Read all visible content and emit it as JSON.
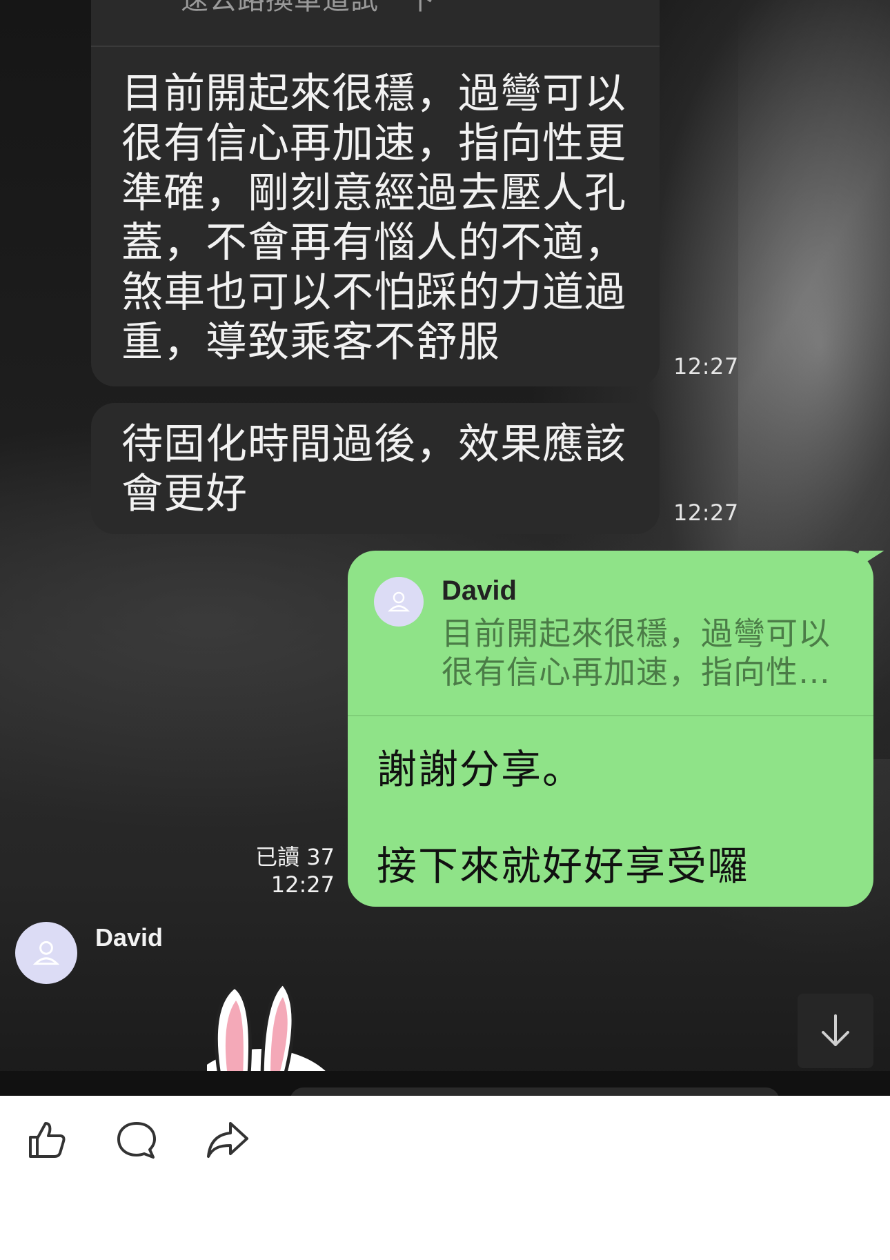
{
  "chat": {
    "top_partial_text": "速公路換車道試一下",
    "incoming": [
      {
        "lines": [
          "目前開起來很穩，過彎可以",
          "很有信心再加速，指向性更",
          "準確，剛刻意經過去壓人孔",
          "蓋，不會再有惱人的不適，",
          "煞車也可以不怕踩的力道過",
          "重，導致乘客不舒服"
        ],
        "time": "12:27"
      },
      {
        "lines": [
          "待固化時間過後，效果應該",
          "會更好"
        ],
        "time": "12:27"
      }
    ],
    "outgoing": {
      "reply_to_name": "David",
      "reply_quote_lines": [
        "目前開起來很穩，過彎可以",
        "很有信心再加速，指向性…"
      ],
      "text_line_1": "謝謝分享。",
      "text_line_2": "接下來就好好享受囉",
      "read_label": "已讀 37",
      "time": "12:27"
    },
    "next_sender": {
      "name": "David",
      "avatar_icon": "person-icon"
    },
    "sticker_icon": "rabbit-sticker",
    "scroll_icon": "arrow-down-icon"
  },
  "actions": [
    {
      "name": "like",
      "icon": "thumbs-up-icon"
    },
    {
      "name": "comment",
      "icon": "speech-bubble-icon"
    },
    {
      "name": "share",
      "icon": "share-arrow-icon"
    }
  ],
  "colors": {
    "outgoing_bubble": "#8fe388",
    "incoming_bubble": "#2a2a2a",
    "avatar_bg": "#dcdcf5"
  }
}
